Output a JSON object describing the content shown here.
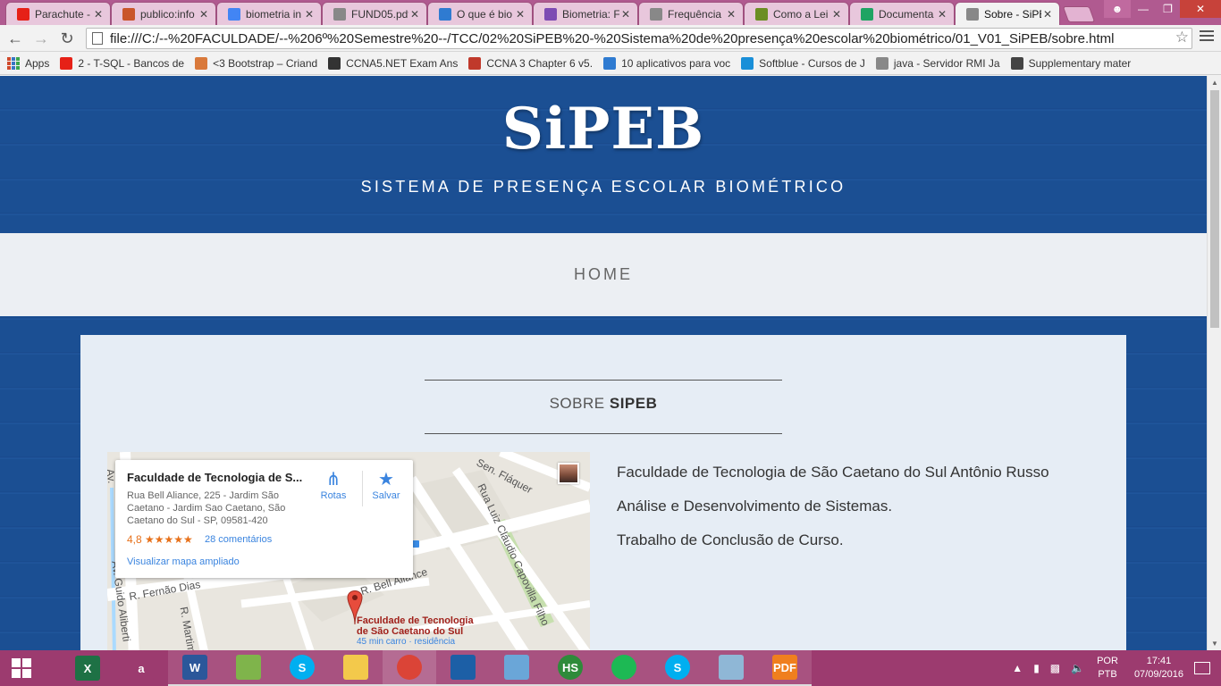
{
  "browser": {
    "tabs": [
      {
        "title": "Parachute -",
        "icon": "youtube-icon",
        "color": "#e62117"
      },
      {
        "title": "publico:info",
        "icon": "document-icon",
        "color": "#c9552a"
      },
      {
        "title": "biometria in",
        "icon": "google-icon",
        "color": "#4285f4"
      },
      {
        "title": "FUND05.pdf",
        "icon": "page-icon",
        "color": "#888888"
      },
      {
        "title": "O que é bio",
        "icon": "network-icon",
        "color": "#2f7bd1"
      },
      {
        "title": "Biometria: F",
        "icon": "purple-logo-icon",
        "color": "#7d4bb3"
      },
      {
        "title": "Frequência",
        "icon": "page-icon",
        "color": "#888888"
      },
      {
        "title": "Como a Lei",
        "icon": "dn-icon",
        "color": "#6b8e23"
      },
      {
        "title": "Documenta",
        "icon": "google-drive-icon",
        "color": "#1fa463"
      },
      {
        "title": "Sobre - SiPE",
        "icon": "page-icon",
        "color": "#888888"
      }
    ],
    "url": "file:///C:/--%20FACULDADE/--%206º%20Semestre%20--/TCC/02%20SiPEB%20-%20Sistema%20de%20presença%20escolar%20biométrico/01_V01_SiPEB/sobre.html",
    "bookmarks": [
      {
        "label": "Apps",
        "icon": "apps-icon"
      },
      {
        "label": "2 - T-SQL - Bancos de",
        "icon": "youtube-icon",
        "color": "#e62117"
      },
      {
        "label": "<3 Bootstrap – Criand",
        "icon": "site-icon",
        "color": "#d9793b"
      },
      {
        "label": "CCNA5.NET Exam Ans",
        "icon": "ccna-icon",
        "color": "#333333"
      },
      {
        "label": "CCNA 3 Chapter 6 v5.",
        "icon": "cisco-icon",
        "color": "#c0392b"
      },
      {
        "label": "10 aplicativos para voc",
        "icon": "link-icon",
        "color": "#2f7bd1"
      },
      {
        "label": "Softblue - Cursos de J",
        "icon": "softblue-icon",
        "color": "#1a8fd8"
      },
      {
        "label": "java - Servidor RMI Ja",
        "icon": "page-icon",
        "color": "#888888"
      },
      {
        "label": "Supplementary mater",
        "icon": "supplementary-icon",
        "color": "#444444"
      }
    ]
  },
  "site": {
    "brand": "SiPEB",
    "tagline": "SISTEMA DE PRESENÇA ESCOLAR BIOMÉTRICO",
    "nav_home": "HOME",
    "section_title_prefix": "SOBRE",
    "section_title_bold": "SIPEB",
    "desc_lines": [
      "Faculdade de Tecnologia de São Caetano do Sul Antônio Russo",
      "Análise e Desenvolvimento de Sistemas.",
      "Trabalho de Conclusão de Curso."
    ]
  },
  "map": {
    "place_title": "Faculdade de Tecnologia de S...",
    "address": "Rua Bell Aliance, 225 - Jardim São Caetano - Jardim Sao Caetano, São Caetano do Sul - SP, 09581-420",
    "rating": "4,8 ★★★★★",
    "comments": "28 comentários",
    "directions_label": "Rotas",
    "save_label": "Salvar",
    "view_larger": "Visualizar mapa ampliado",
    "pin_label_1": "Faculdade de Tecnologia",
    "pin_label_2": "de São Caetano do Sul",
    "pin_sub": "45 min carro · residência",
    "streets": {
      "sen_flaquer": "Sen. Fláquer",
      "luiz_claudio": "Rua Luiz Cláudio Capovilla Filho",
      "bell_aliance": "R. Bell Aliance",
      "fernao_dias": "R. Fernão Dias",
      "martim": "R. Martim",
      "guido": "Av. Guido Aliberti",
      "av": "Av."
    }
  },
  "taskbar": {
    "apps": [
      {
        "name": "excel",
        "label": "X",
        "color": "#1e7145"
      },
      {
        "name": "avast",
        "label": "a",
        "color": "#9c3b6f"
      },
      {
        "name": "word",
        "label": "W",
        "color": "#2b579a"
      },
      {
        "name": "folder-green",
        "label": "",
        "color": "#7fb44b"
      },
      {
        "name": "skype",
        "label": "S",
        "color": "#00aff0"
      },
      {
        "name": "file-explorer",
        "label": "",
        "color": "#f3c94b"
      },
      {
        "name": "chrome",
        "label": "",
        "color": "#db4437"
      },
      {
        "name": "virtualbox",
        "label": "",
        "color": "#1c5fa6"
      },
      {
        "name": "box-3d",
        "label": "",
        "color": "#6aa6d8"
      },
      {
        "name": "hotspot-shield",
        "label": "HS",
        "color": "#2e8b3a"
      },
      {
        "name": "spotify",
        "label": "",
        "color": "#1db954"
      },
      {
        "name": "skype-2",
        "label": "S",
        "color": "#00aff0"
      },
      {
        "name": "notes",
        "label": "",
        "color": "#8fb7d6"
      },
      {
        "name": "pdf",
        "label": "PDF",
        "color": "#f07f1e"
      }
    ],
    "lang_1": "POR",
    "lang_2": "PTB",
    "time": "17:41",
    "date": "07/09/2016"
  }
}
